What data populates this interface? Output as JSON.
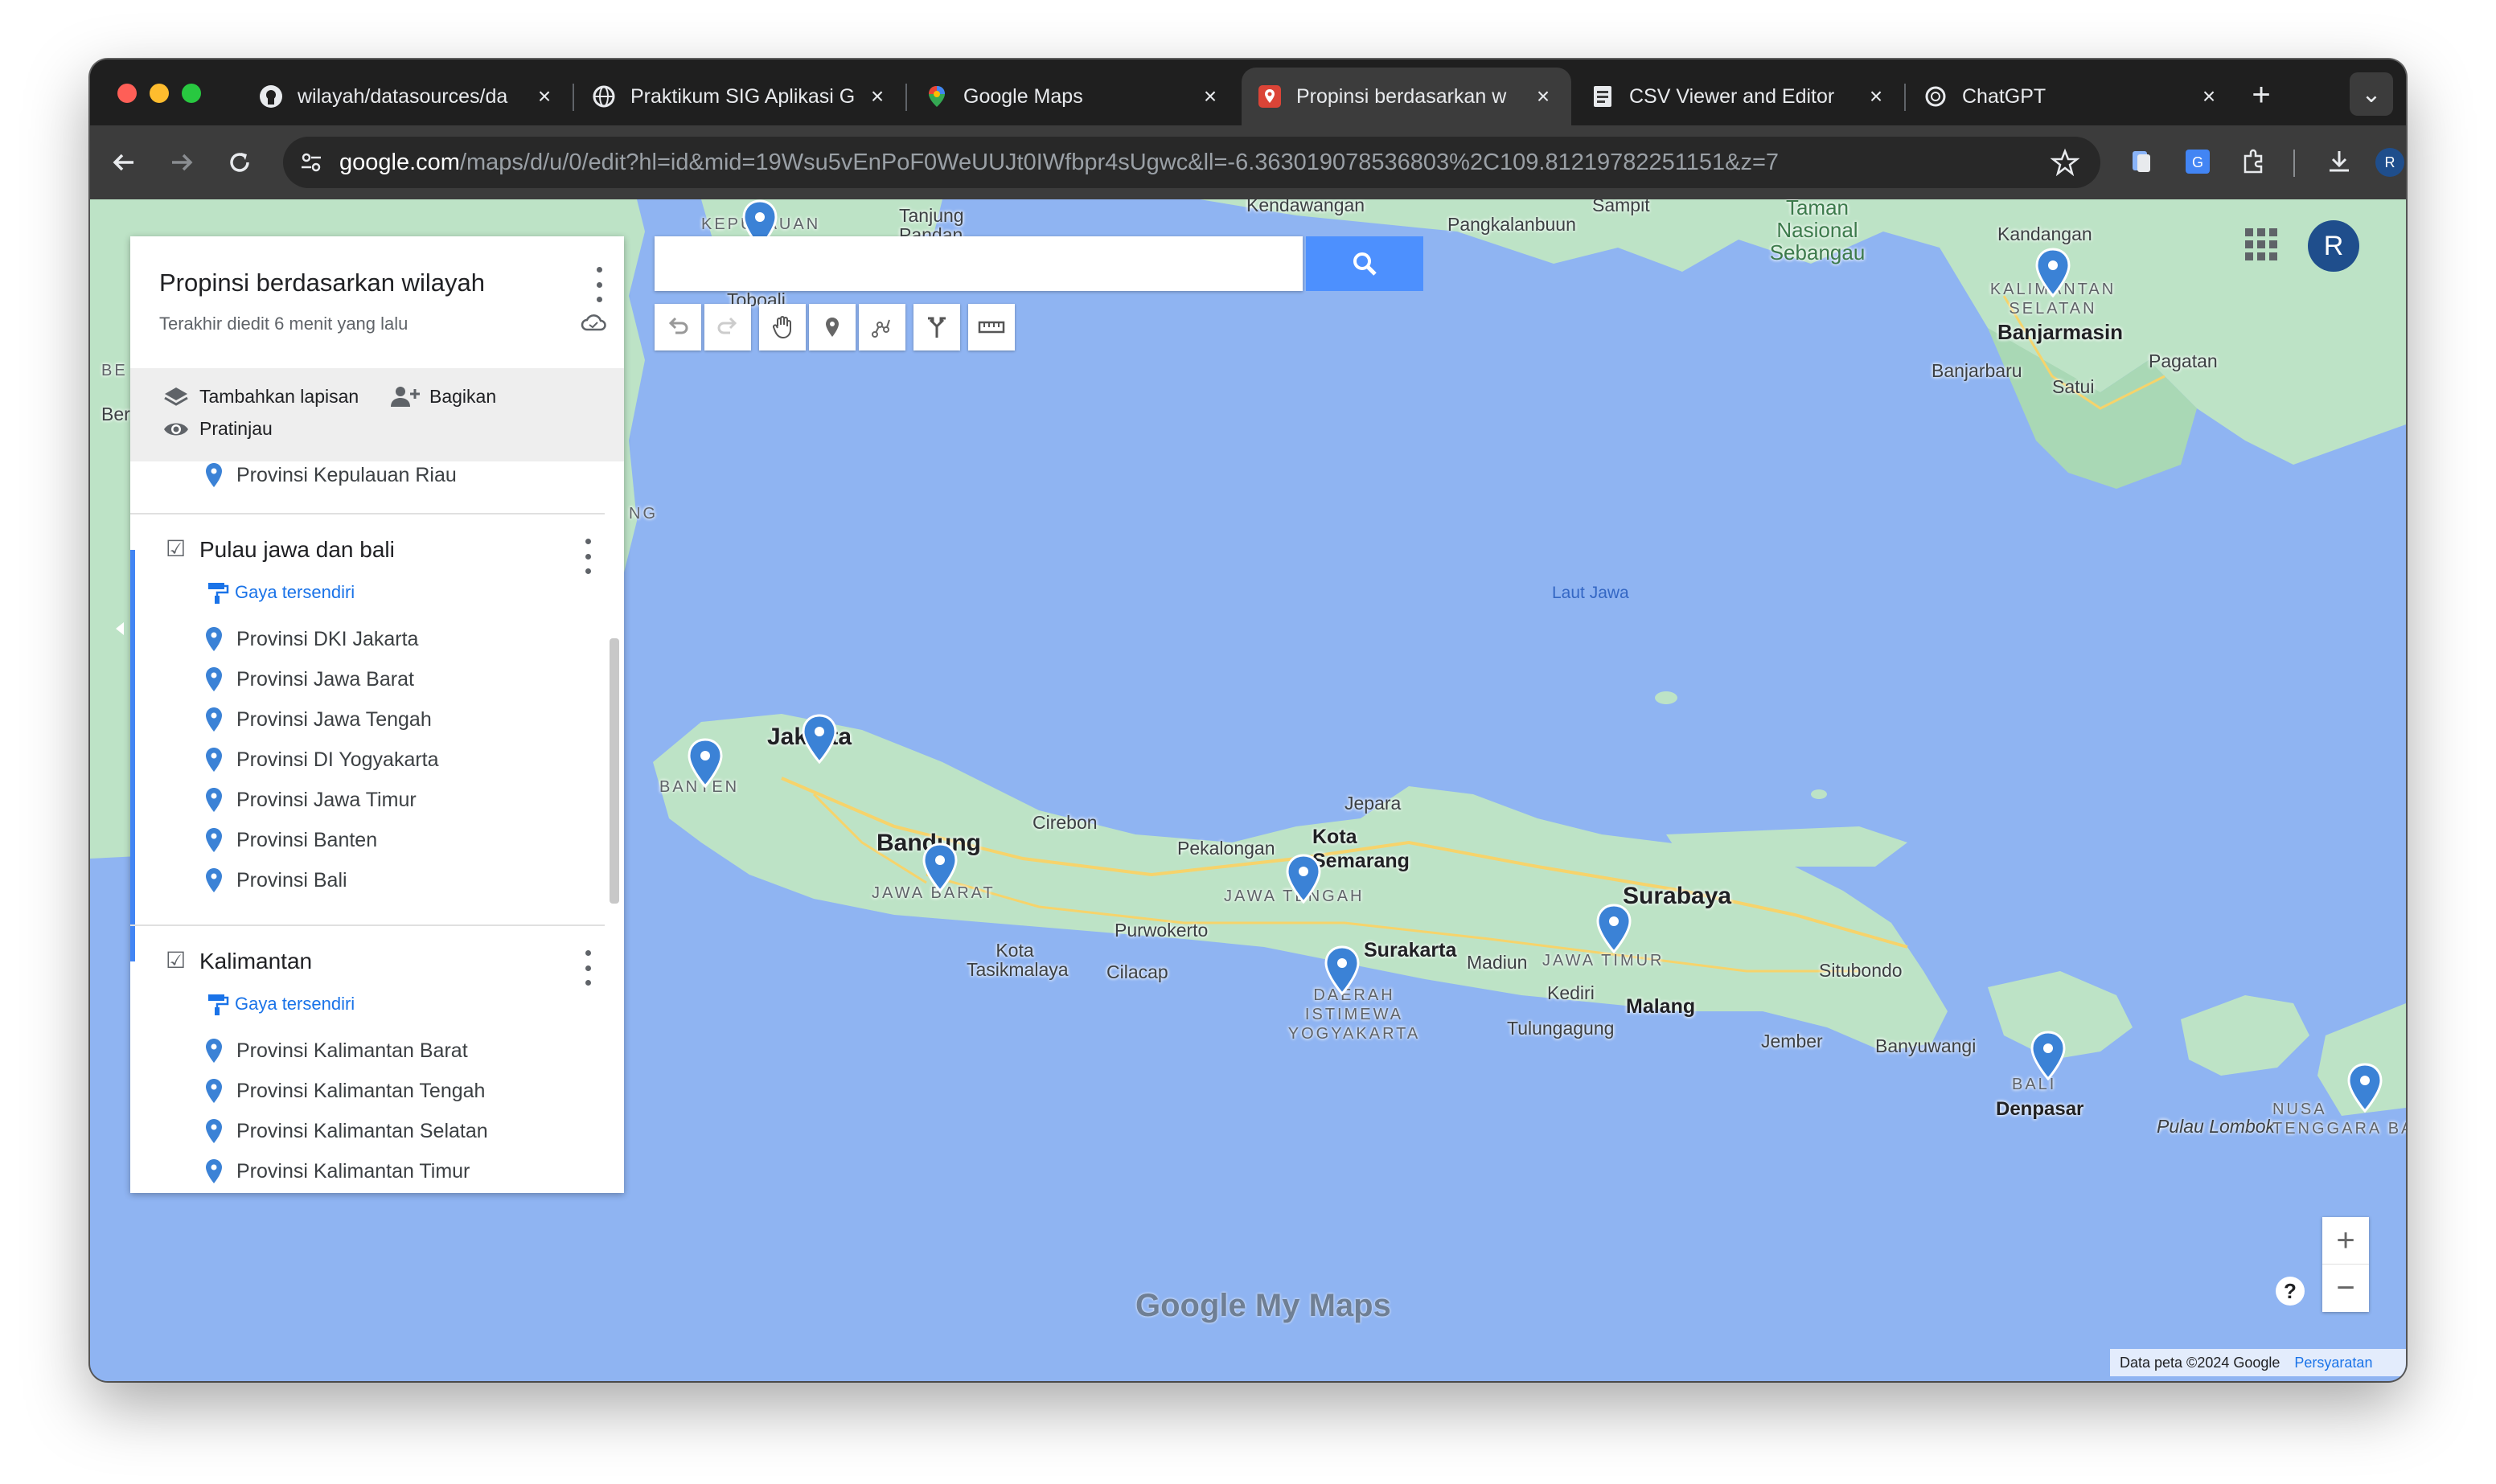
{
  "browser": {
    "tabs": [
      {
        "title": "wilayah/datasources/da",
        "favicon": "github-icon",
        "active": false
      },
      {
        "title": "Praktikum SIG Aplikasi G",
        "favicon": "globe-icon",
        "active": false
      },
      {
        "title": "Google Maps",
        "favicon": "maps-pin-icon",
        "active": false
      },
      {
        "title": "Propinsi berdasarkan w",
        "favicon": "mymaps-icon",
        "active": true
      },
      {
        "title": "CSV Viewer and Editor",
        "favicon": "document-icon",
        "active": false
      },
      {
        "title": "ChatGPT",
        "favicon": "openai-icon",
        "active": false
      }
    ],
    "new_tab": "+",
    "tab_search": "⌄",
    "url_host": "google.com",
    "url_path": "/maps/d/u/0/edit?hl=id&mid=19Wsu5vEnPoF0WeUUJt0IWfbpr4sUgwc&ll=-6.363019078536803%2C109.81219782251151&z=7",
    "profile_initial": "R"
  },
  "panel": {
    "title": "Propinsi berdasarkan wilayah",
    "subtitle": "Terakhir diedit 6 menit yang lalu",
    "actions": {
      "add_layer": "Tambahkan lapisan",
      "share": "Bagikan",
      "preview": "Pratinjau"
    },
    "partial_item": "Provinsi Kepulauan Riau",
    "layers": [
      {
        "name": "Pulau jawa dan bali",
        "checked": true,
        "style": "Gaya tersendiri",
        "items": [
          "Provinsi DKI Jakarta",
          "Provinsi Jawa Barat",
          "Provinsi Jawa Tengah",
          "Provinsi DI Yogyakarta",
          "Provinsi Jawa Timur",
          "Provinsi Banten",
          "Provinsi Bali"
        ]
      },
      {
        "name": "Kalimantan",
        "checked": true,
        "style": "Gaya tersendiri",
        "items": [
          "Provinsi Kalimantan Barat",
          "Provinsi Kalimantan Tengah",
          "Provinsi Kalimantan Selatan",
          "Provinsi Kalimantan Timur"
        ]
      }
    ]
  },
  "search": {
    "placeholder": ""
  },
  "map": {
    "labels": {
      "kepulauan": "KEPULAUAN",
      "tanjung_pandan": "Tanjung Pandan",
      "tobaali": "Toboali",
      "kendawangan": "Kendawangan",
      "pangkalanbuun": "Pangkalanbuun",
      "sampit": "Sampit",
      "taman_nasional": "Taman Nasional Sebangau",
      "kandangan": "Kandangan",
      "kalimantan_selatan": "KALIMANTAN SELATAN",
      "banjarmasin": "Banjarmasin",
      "banjarbaru": "Banjarbaru",
      "satui": "Satui",
      "pagatan": "Pagatan",
      "laut_jawa": "Laut Jawa",
      "jakarta": "Jakarta",
      "banten": "BANTEN",
      "bandung": "Bandung",
      "jawa_barat": "JAWA BARAT",
      "cirebon": "Cirebon",
      "pekalongan": "Pekalongan",
      "kota_semarang": "Kota Semarang",
      "jepara": "Jepara",
      "jawa_tengah": "JAWA TENGAH",
      "surabaya": "Surabaya",
      "purwokerto": "Purwokerto",
      "kota_tasikmalaya": "Kota Tasikmalaya",
      "cilacap": "Cilacap",
      "surakarta": "Surakarta",
      "madiun": "Madiun",
      "jawa_timur": "JAWA TIMUR",
      "kediri": "Kediri",
      "tulungagung": "Tulungagung",
      "malang": "Malang",
      "diy": "DAERAH ISTIMEWA YOGYAKARTA",
      "situbondo": "Situbondo",
      "jember": "Jember",
      "banyuwangi": "Banyuwangi",
      "bali": "BALI",
      "denpasar": "Denpasar",
      "pulau_lombok": "Pulau Lombok",
      "ntb": "NUSA TENGGARA BA",
      "ng": "NG",
      "be": "BE",
      "ber": "Ber"
    },
    "attribution": "Data peta ©2024 Google",
    "terms": "Persyaratan",
    "logo_text": "Google My Maps",
    "zoom_in": "+",
    "zoom_out": "−",
    "help": "?",
    "colors": {
      "water": "#8fb4f2",
      "land": "#bde3c6",
      "pin": "#3b82d6"
    }
  }
}
